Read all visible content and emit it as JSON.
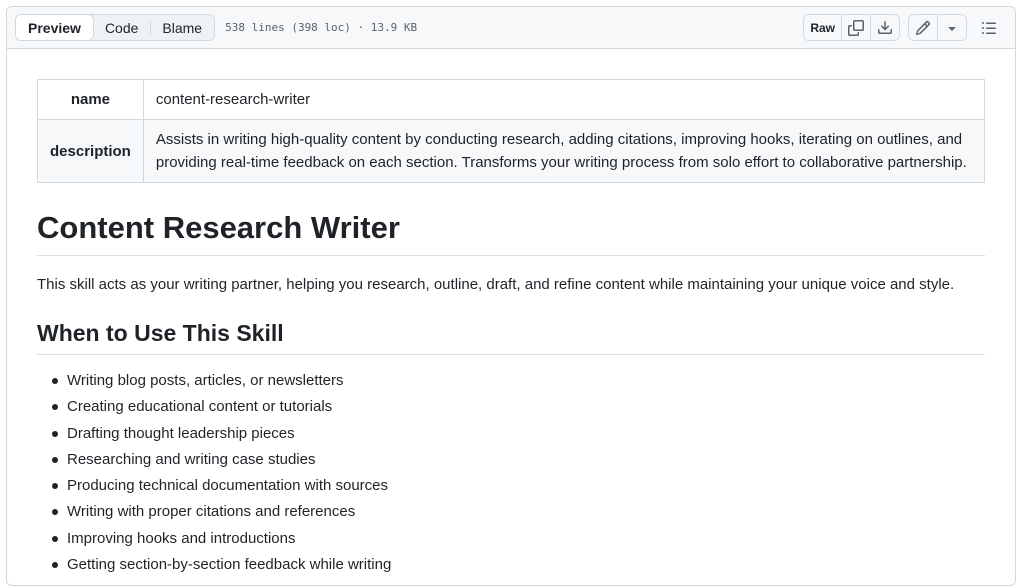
{
  "toolbar": {
    "tabs": [
      {
        "label": "Preview",
        "active": true
      },
      {
        "label": "Code",
        "active": false
      },
      {
        "label": "Blame",
        "active": false
      }
    ],
    "file_info": "538 lines (398 loc) · 13.9 KB",
    "raw_label": "Raw",
    "icons": [
      "copy-icon",
      "download-icon",
      "pencil-icon",
      "triangle-down-icon",
      "list-icon"
    ]
  },
  "frontmatter": {
    "rows": [
      {
        "key": "name",
        "value": "content-research-writer"
      },
      {
        "key": "description",
        "value": "Assists in writing high-quality content by conducting research, adding citations, improving hooks, iterating on outlines, and providing real-time feedback on each section. Transforms your writing process from solo effort to collaborative partnership."
      }
    ]
  },
  "doc": {
    "title": "Content Research Writer",
    "intro": "This skill acts as your writing partner, helping you research, outline, draft, and refine content while maintaining your unique voice and style.",
    "section_heading": "When to Use This Skill",
    "items": [
      "Writing blog posts, articles, or newsletters",
      "Creating educational content or tutorials",
      "Drafting thought leadership pieces",
      "Researching and writing case studies",
      "Producing technical documentation with sources",
      "Writing with proper citations and references",
      "Improving hooks and introductions",
      "Getting section-by-section feedback while writing"
    ]
  },
  "colors": {
    "border": "#d1d9e0",
    "text": "#1f2328",
    "muted": "#59636e",
    "toolbar_bg": "#f6f8fa"
  }
}
